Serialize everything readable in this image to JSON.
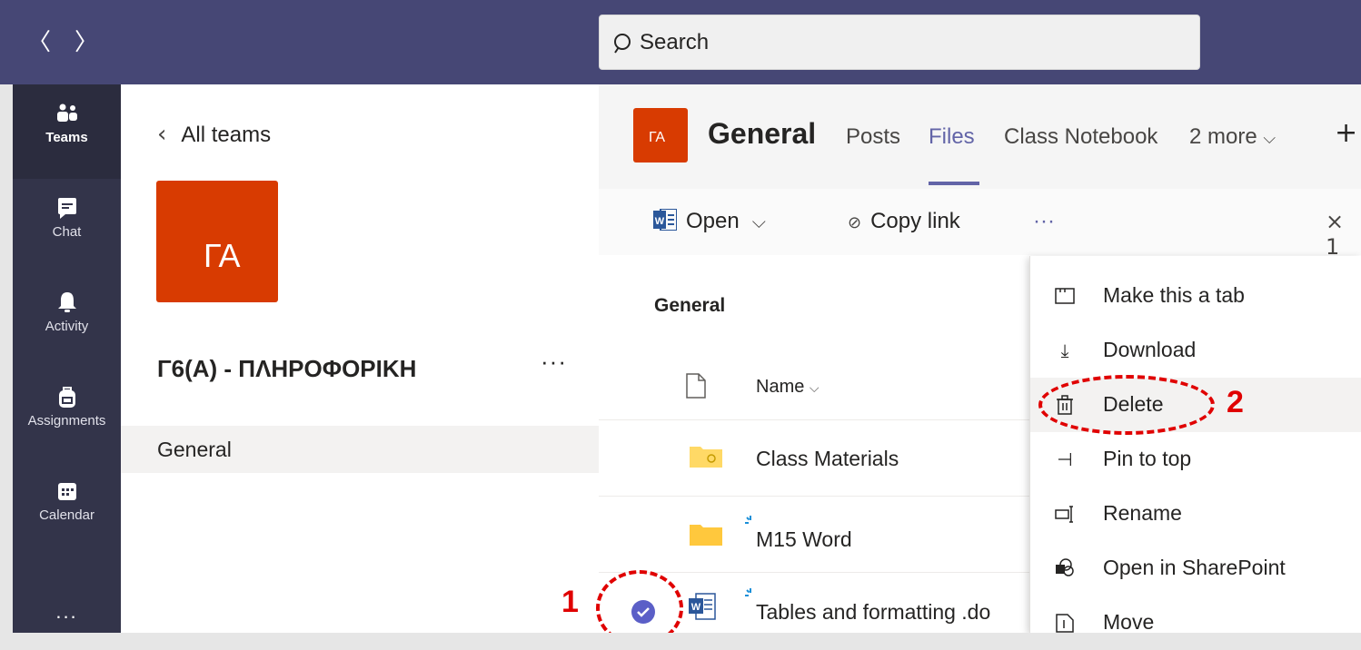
{
  "topbar": {
    "back_glyph": "〈",
    "forward_glyph": "〉",
    "search_placeholder": "Search"
  },
  "appbar": {
    "items": [
      {
        "label": "Teams",
        "icon": "teams-icon",
        "active": true
      },
      {
        "label": "Chat",
        "icon": "chat-icon"
      },
      {
        "label": "Activity",
        "icon": "bell-icon"
      },
      {
        "label": "Assignments",
        "icon": "backpack-icon"
      },
      {
        "label": "Calendar",
        "icon": "calendar-icon"
      }
    ],
    "more": "..."
  },
  "teampanel": {
    "back_label": "All teams",
    "avatar_initials": "ΓΑ",
    "team_name": "Γ6(Α) - ΠΛΗΡΟΦΟΡΙΚΗ",
    "more": "···",
    "channels": [
      "General"
    ]
  },
  "header": {
    "avatar_initials": "ΓΑ",
    "channel_title": "General",
    "tabs": [
      "Posts",
      "Files",
      "Class Notebook",
      "2 more"
    ],
    "active_tab": "Files",
    "plus": "+"
  },
  "cmdbar": {
    "open_label": "Open",
    "copy_link_label": "Copy link",
    "more": "···",
    "selected_count": "1"
  },
  "files": {
    "breadcrumb": "General",
    "name_header": "Name",
    "rows": [
      {
        "name": "Class Materials",
        "type": "linked-folder"
      },
      {
        "name": "M15 Word",
        "type": "folder",
        "new": true
      },
      {
        "name": "Tables and formatting .do",
        "type": "word",
        "new": true,
        "selected": true
      }
    ]
  },
  "context_menu": {
    "items": [
      {
        "label": "Make this a tab",
        "icon": "tab-icon"
      },
      {
        "label": "Download",
        "icon": "download-icon"
      },
      {
        "label": "Delete",
        "icon": "trash-icon",
        "hover": true
      },
      {
        "label": "Pin to top",
        "icon": "pin-icon"
      },
      {
        "label": "Rename",
        "icon": "rename-icon"
      },
      {
        "label": "Open in SharePoint",
        "icon": "sharepoint-icon"
      },
      {
        "label": "Move",
        "icon": "move-icon"
      }
    ]
  },
  "annotations": {
    "step1": "1",
    "step2": "2",
    "color": "#e00000"
  },
  "colors": {
    "topbar": "#464775",
    "appbar": "#33344a",
    "accent": "#6264a7",
    "avatar": "#d83b01"
  }
}
